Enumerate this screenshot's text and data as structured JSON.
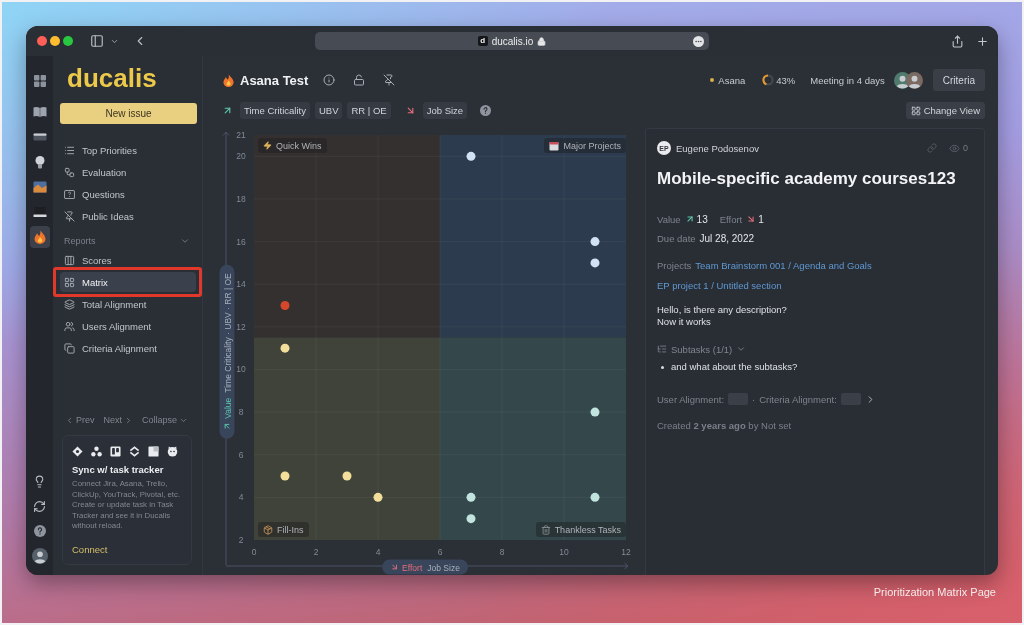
{
  "browser": {
    "favicon": "d",
    "url": "ducalis.io"
  },
  "rail": {
    "items": [
      {
        "selected": false
      },
      {
        "selected": false
      },
      {
        "selected": false
      },
      {
        "selected": false
      },
      {
        "selected": false
      },
      {
        "selected": false
      },
      {
        "selected": true
      }
    ]
  },
  "sidebar": {
    "logo": "ducalis",
    "new_issue": "New issue",
    "nav": [
      {
        "label": "Top Priorities",
        "selected": false
      },
      {
        "label": "Evaluation",
        "selected": false
      },
      {
        "label": "Questions",
        "selected": false
      },
      {
        "label": "Public Ideas",
        "selected": false
      }
    ],
    "reports": {
      "label": "Reports",
      "expanded": true,
      "items": [
        {
          "label": "Scores",
          "selected": false,
          "highlighted": false
        },
        {
          "label": "Matrix",
          "selected": true,
          "highlighted": true
        },
        {
          "label": "Total Alignment",
          "selected": false,
          "highlighted": false
        },
        {
          "label": "Users Alignment",
          "selected": false,
          "highlighted": false
        },
        {
          "label": "Criteria Alignment",
          "selected": false,
          "highlighted": false
        }
      ]
    },
    "pager": {
      "prev": "Prev",
      "next": "Next",
      "collapse": "Collapse"
    },
    "sync_card": {
      "title": "Sync w/ task tracker",
      "text": "Connect Jira, Asana, Trello, ClickUp, YouTrack, Pivotal, etc. Create or update task in Task Tracker and see it in Ducalis without reload.",
      "link": "Connect"
    }
  },
  "header": {
    "title": "Asana Test",
    "integration": "Asana",
    "progress": {
      "level": 0.43,
      "reading": "43%"
    },
    "meeting": "Meeting in 4 days",
    "criteria_button": "Criteria"
  },
  "formula": {
    "value_criteria": [
      "Time Criticality",
      "UBV",
      "RR | OE"
    ],
    "effort_criteria": [
      "Job Size"
    ],
    "change_view_button": "Change View"
  },
  "matrix": {
    "y_axis": {
      "title": "Value"
    },
    "x_axis": {
      "title": "Effort"
    },
    "quadrants": [
      {
        "label": "Quick Wins",
        "color": "#33302f"
      },
      {
        "label": "Major Projects",
        "color": "#2c3b4d"
      },
      {
        "label": "Fill-Ins",
        "color": "#40433a"
      },
      {
        "label": "Thankless Tasks",
        "color": "#34474b"
      }
    ],
    "chart_data": {
      "type": "scatter",
      "xlabel": "Job Size",
      "ylabel": "Time Criticality · UBV · RR | OE",
      "x": [
        1,
        1,
        1,
        3,
        4,
        7,
        7,
        7,
        11,
        11,
        11,
        11
      ],
      "xlim": [
        0,
        12
      ],
      "ylim": [
        2,
        21
      ],
      "xticks": [
        0,
        2,
        4,
        6,
        8,
        10,
        12
      ],
      "yticks": [
        2,
        4,
        6,
        8,
        10,
        12,
        14,
        16,
        18,
        20,
        21
      ],
      "grid": true,
      "series": [
        {
          "color": "#d2e2f5",
          "values": [
            null,
            null,
            null,
            null,
            null,
            20,
            null,
            null,
            16,
            15,
            null,
            null
          ]
        },
        {
          "color": "#f3df9b",
          "values": [
            null,
            11,
            5,
            5,
            4,
            null,
            null,
            null,
            null,
            null,
            null,
            null
          ]
        },
        {
          "color": "#c2e4df",
          "values": [
            null,
            null,
            null,
            null,
            null,
            null,
            4,
            3,
            null,
            null,
            8,
            4
          ]
        },
        {
          "color": "#d4472b",
          "values": [
            13,
            null,
            null,
            null,
            null,
            null,
            null,
            null,
            null,
            null,
            null,
            null
          ]
        }
      ]
    }
  },
  "detail": {
    "author": {
      "initials": "EP",
      "name": "Eugene Podosenov"
    },
    "views": "0",
    "title": "Mobile-specific academy courses123",
    "scores": [
      {
        "label": "Value",
        "score": "13"
      },
      {
        "label": "Effort",
        "score": "1"
      }
    ],
    "due": {
      "label": "Due date",
      "date": "Jul 28, 2022"
    },
    "projects": {
      "label": "Projects",
      "links": [
        "Team Brainstorm 001 / Agenda and Goals",
        "EP project 1 / Untitled section"
      ]
    },
    "description": [
      "Hello, is there any description?",
      "Now it works"
    ],
    "subtasks": {
      "label": "Subtasks (1/1)",
      "expanded": true,
      "items": [
        "and what about the subtasks?"
      ]
    },
    "alignment": {
      "items": [
        {
          "label": "User Alignment:"
        },
        {
          "label": "Criteria Alignment:"
        }
      ],
      "separator": "·"
    },
    "created": "Created **2 years ago** by Not set"
  },
  "caption": "Prioritization Matrix Page"
}
